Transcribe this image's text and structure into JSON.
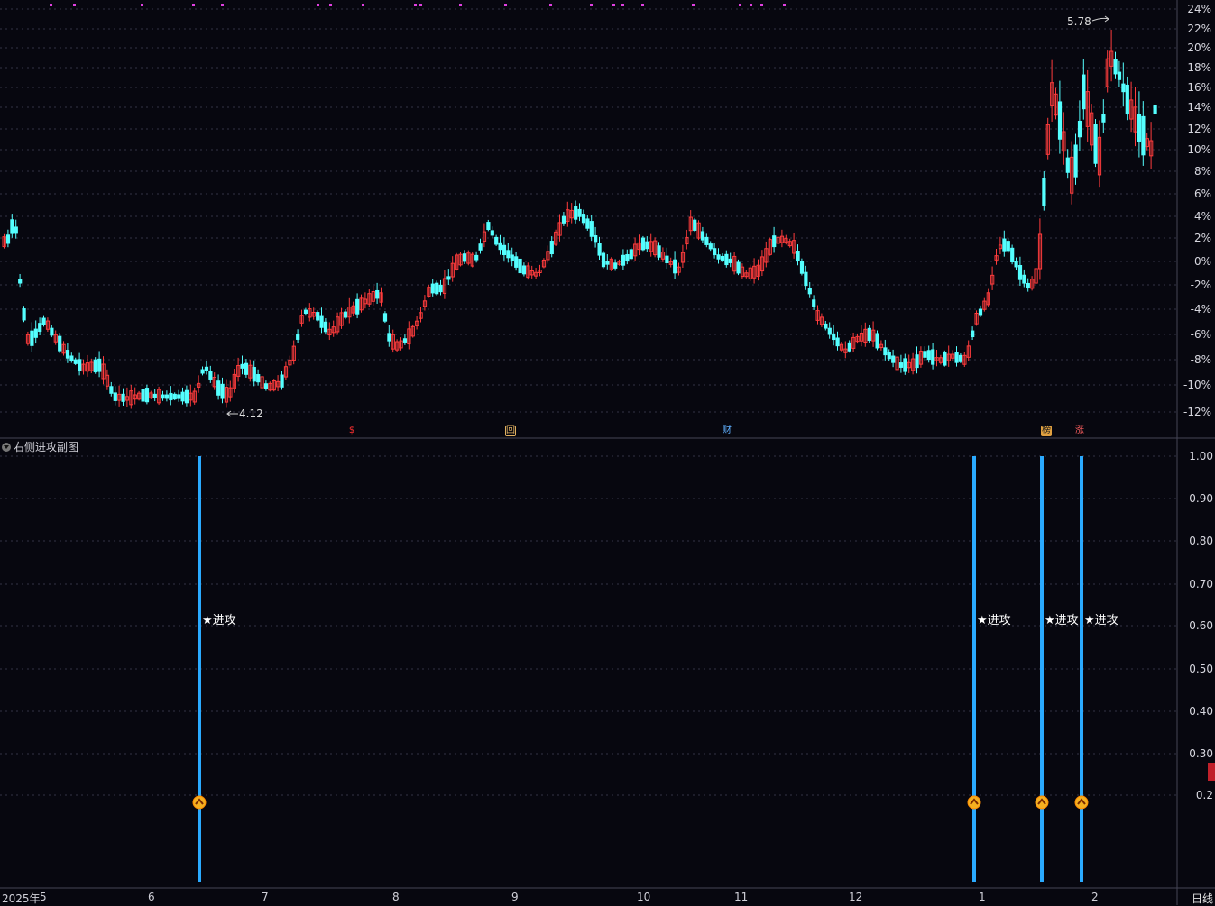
{
  "main_chart": {
    "y_axis_labels": [
      "24%",
      "22%",
      "20%",
      "18%",
      "16%",
      "14%",
      "12%",
      "10%",
      "8%",
      "6%",
      "4%",
      "2%",
      "0%",
      "-2%",
      "-4%",
      "-6%",
      "-8%",
      "-10%",
      "-12%"
    ],
    "high_marker": "5.78",
    "low_marker": "4.12",
    "event_markers": [
      {
        "glyph": "$",
        "color": "#ff3030"
      },
      {
        "glyph": "回",
        "color": "#e0b060"
      },
      {
        "glyph": "财",
        "color": "#60b0ff"
      },
      {
        "glyph": "榜",
        "color": "#e0a040"
      },
      {
        "glyph": "涨",
        "color": "#ff6060"
      }
    ],
    "colors": {
      "up": "#ff3c3c",
      "down": "#54ffff",
      "grid": "#333344",
      "top_dots": "#e040e0"
    }
  },
  "sub_chart": {
    "title": "右侧进攻副图",
    "signal_label": "★进攻",
    "y_axis_labels": [
      "1.00",
      "0.90",
      "0.80",
      "0.70",
      "0.60",
      "0.50",
      "0.40",
      "0.30",
      "0.2"
    ],
    "signal_color": "#2aaaff"
  },
  "time_axis": {
    "months": [
      "2025年",
      "5",
      "6",
      "7",
      "8",
      "9",
      "10",
      "11",
      "12",
      "1",
      "2"
    ],
    "period": "日线"
  }
}
